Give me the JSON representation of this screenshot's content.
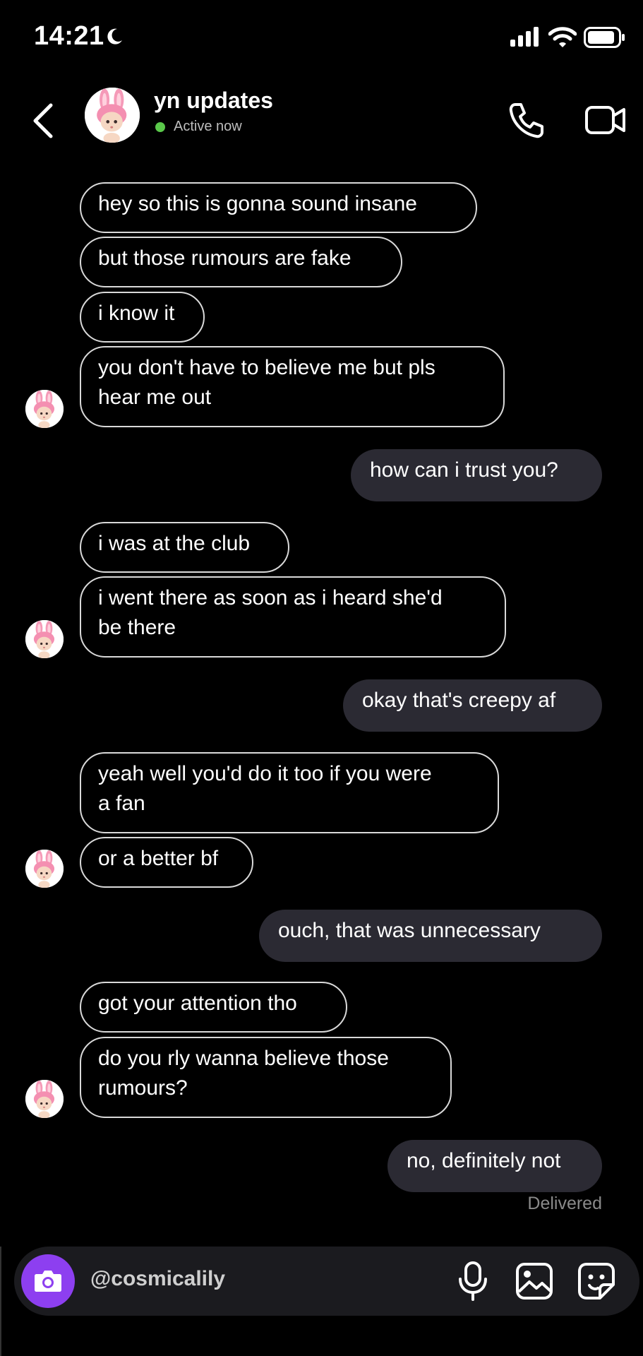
{
  "status_bar": {
    "time": "14:21"
  },
  "header": {
    "contact_name": "yn updates",
    "status": "Active now"
  },
  "messages": [
    {
      "text": "hey so this is gonna sound insane"
    },
    {
      "text": "but those rumours are fake"
    },
    {
      "text": "i know it"
    },
    {
      "line1": "you don't have to believe me but pls",
      "line2": "hear me out"
    },
    {
      "text": "how can i trust you?"
    },
    {
      "text": "i was at the club"
    },
    {
      "line1": "i went there as soon as i heard she'd",
      "line2": "be there"
    },
    {
      "text": "okay that's creepy af"
    },
    {
      "line1": "yeah well you'd do it too if you were",
      "line2": "a fan"
    },
    {
      "text": "or a better bf"
    },
    {
      "text": "ouch, that was unnecessary"
    },
    {
      "text": "got your attention tho"
    },
    {
      "line1": "do you rly wanna believe those",
      "line2": "rumours?"
    },
    {
      "text": "no, definitely not"
    }
  ],
  "delivered_label": "Delivered",
  "composer": {
    "value": "@cosmicalily"
  },
  "icons": {
    "moon": "moon-icon",
    "signal": "signal-icon",
    "wifi": "wifi-icon",
    "battery": "battery-icon",
    "back": "back-chevron-icon",
    "call": "phone-icon",
    "video": "video-camera-icon",
    "camera": "camera-icon",
    "mic": "microphone-icon",
    "gallery": "gallery-icon",
    "sticker": "sticker-icon"
  },
  "colors": {
    "background": "#000000",
    "sent_bubble": "#2b2a33",
    "active_dot": "#5ac84a",
    "camera_button": "#8d3ff0"
  }
}
